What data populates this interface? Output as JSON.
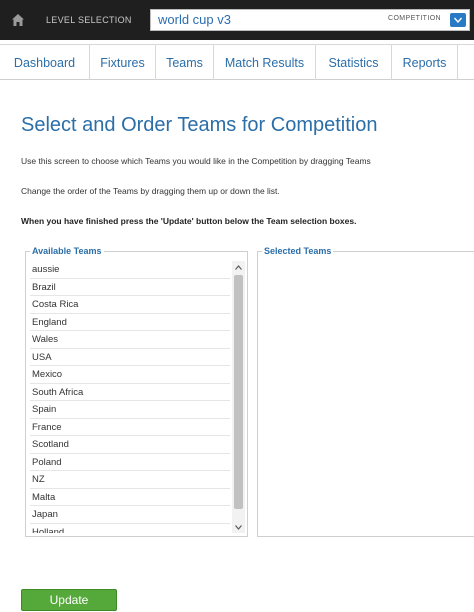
{
  "topbar": {
    "level_label": "LEVEL SELECTION",
    "project_name": "world cup v3",
    "competition_label": "COMPETITION",
    "home_icon": "home-icon",
    "dropdown_icon": "chevron-down-icon"
  },
  "nav": {
    "items": [
      {
        "label": "Dashboard"
      },
      {
        "label": "Fixtures"
      },
      {
        "label": "Teams"
      },
      {
        "label": "Match Results"
      },
      {
        "label": "Statistics"
      },
      {
        "label": "Reports"
      }
    ]
  },
  "page": {
    "title": "Select and Order Teams for Competition",
    "instructions": [
      "Use this screen to choose which Teams you would like in the Competition by dragging Teams",
      "Change the order of the Teams by dragging them up or down the list.",
      "When you have finished press the 'Update' button below the Team selection boxes."
    ]
  },
  "available": {
    "legend": "Available Teams",
    "teams": [
      "aussie",
      "Brazil",
      "Costa Rica",
      "England",
      "Wales",
      "USA",
      "Mexico",
      "South Africa",
      "Spain",
      "France",
      "Scotland",
      "Poland",
      "NZ",
      "Malta",
      "Japan",
      "Holland"
    ]
  },
  "selected": {
    "legend": "Selected Teams",
    "teams": []
  },
  "actions": {
    "update_label": "Update"
  },
  "colors": {
    "topbar_bg": "#1f1f1f",
    "accent_blue": "#2b6ea8",
    "update_green": "#55a93a"
  }
}
